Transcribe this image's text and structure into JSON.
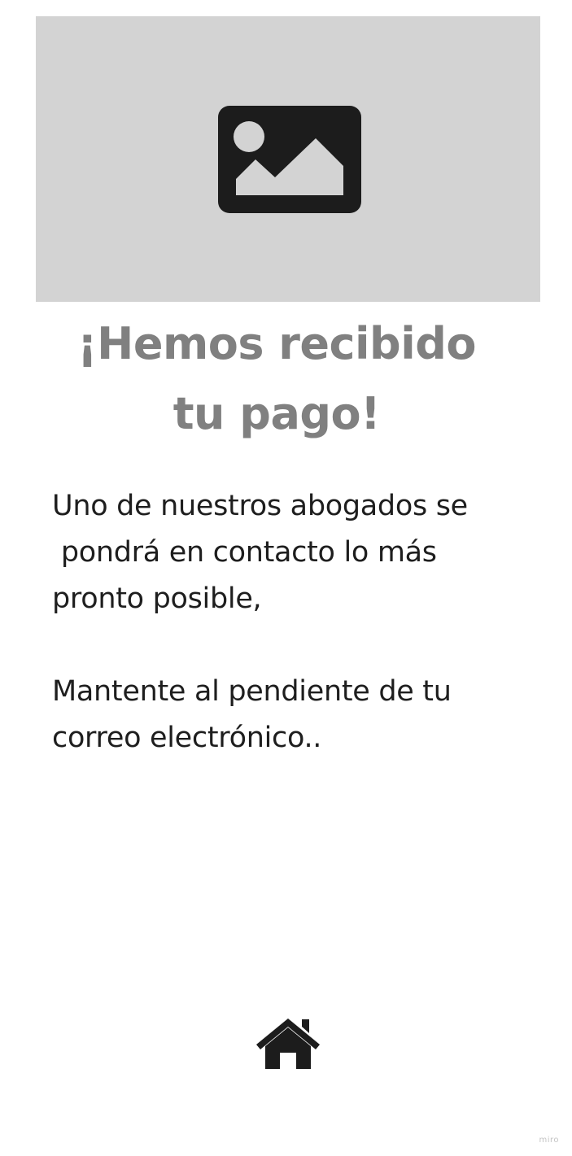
{
  "hero": {
    "icon": "image-placeholder-icon",
    "background_color": "#d3d3d3"
  },
  "title": {
    "line1": "¡Hemos recibido",
    "line2": "tu pago!",
    "color": "#808080"
  },
  "message": {
    "line1": "Uno de nuestros abogados se",
    "line2": " pondrá en contacto lo más",
    "line3": "pronto posible,",
    "line4": "Mantente al pendiente de tu",
    "line5": "correo electrónico.."
  },
  "nav": {
    "home_icon": "home-icon"
  },
  "watermark": {
    "text": "miro"
  }
}
